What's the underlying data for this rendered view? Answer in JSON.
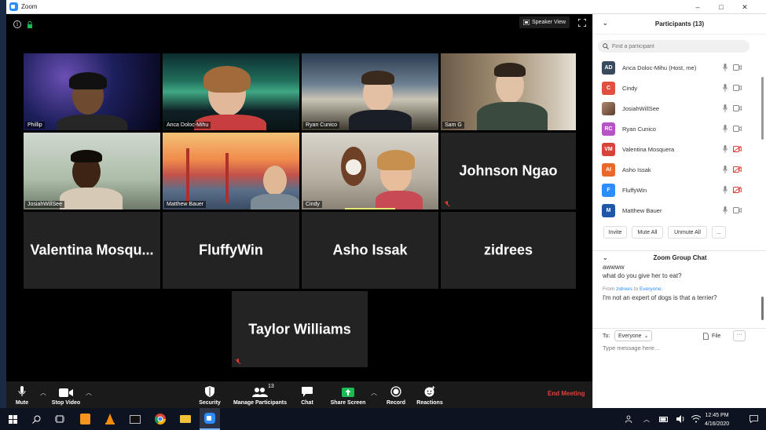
{
  "window": {
    "title": "Zoom",
    "controls": [
      "–",
      "□",
      "✕"
    ]
  },
  "video": {
    "view_button": "Speaker View",
    "tiles": [
      {
        "name": "Phillip",
        "type": "video"
      },
      {
        "name": "Anca Doloc-Mihu",
        "type": "video"
      },
      {
        "name": "Ryan Cunico",
        "type": "video"
      },
      {
        "name": "Sam G",
        "type": "video"
      },
      {
        "name": "JosiahWillSee",
        "type": "video",
        "active": true
      },
      {
        "name": "Matthew Bauer",
        "type": "video"
      },
      {
        "name": "Cindy",
        "type": "video"
      },
      {
        "name": "Johnson Ngao",
        "type": "name",
        "muted": true
      },
      {
        "name": "Valentina  Mosqu...",
        "type": "name"
      },
      {
        "name": "FluffyWin",
        "type": "name"
      },
      {
        "name": "Asho Issak",
        "type": "name"
      },
      {
        "name": "zidrees",
        "type": "name"
      },
      {
        "name": "Taylor Williams",
        "type": "name",
        "muted": true
      }
    ]
  },
  "toolbar": {
    "mute": "Mute",
    "stop_video": "Stop Video",
    "security": "Security",
    "manage_participants": "Manage Participants",
    "participant_count": "13",
    "chat": "Chat",
    "share_screen": "Share Screen",
    "record": "Record",
    "reactions": "Reactions",
    "end_meeting": "End Meeting"
  },
  "participants_panel": {
    "title": "Participants (13)",
    "search_placeholder": "Find a participant",
    "items": [
      {
        "initials": "AD",
        "name": "Anca Doloc-Mihu (Host, me)",
        "color": "#3a4a5e",
        "cam_off": false
      },
      {
        "initials": "C",
        "name": "Cindy",
        "color": "#e0503e",
        "cam_off": false
      },
      {
        "initials": "",
        "name": "JosiahWillSee",
        "color": "#8a6a55",
        "cam_off": false,
        "photo": true
      },
      {
        "initials": "RC",
        "name": "Ryan Cunico",
        "color": "#b554c4",
        "cam_off": false
      },
      {
        "initials": "VM",
        "name": "Valentina Mosquera",
        "color": "#d9443a",
        "cam_off": true
      },
      {
        "initials": "AI",
        "name": "Asho Issak",
        "color": "#e8692a",
        "cam_off": true
      },
      {
        "initials": "F",
        "name": "FluffyWin",
        "color": "#2d8cff",
        "cam_off": true
      },
      {
        "initials": "M",
        "name": "Matthew Bauer",
        "color": "#1f57a8",
        "cam_off": false
      }
    ],
    "buttons": {
      "invite": "Invite",
      "mute_all": "Mute All",
      "unmute_all": "Unmute All",
      "more": "..."
    }
  },
  "chat": {
    "title": "Zoom Group Chat",
    "partial_line": "awwww",
    "line1": "what do you give her to eat?",
    "meta_from": "From",
    "meta_sender": "zidrees",
    "meta_to": "to",
    "meta_recipient": "Everyone:",
    "line2": "I'm not an expert of dogs is that a terrier?",
    "to_label": "To:",
    "to_value": "Everyone",
    "file_label": "File",
    "more_label": "···",
    "input_placeholder": "Type message here..."
  },
  "taskbar": {
    "time": "12:45 PM",
    "date": "4/16/2020"
  },
  "colors": {
    "accent": "#2d8cff",
    "danger": "#e0403a",
    "active_speaker": "#e7e873",
    "share_green": "#1db954"
  }
}
